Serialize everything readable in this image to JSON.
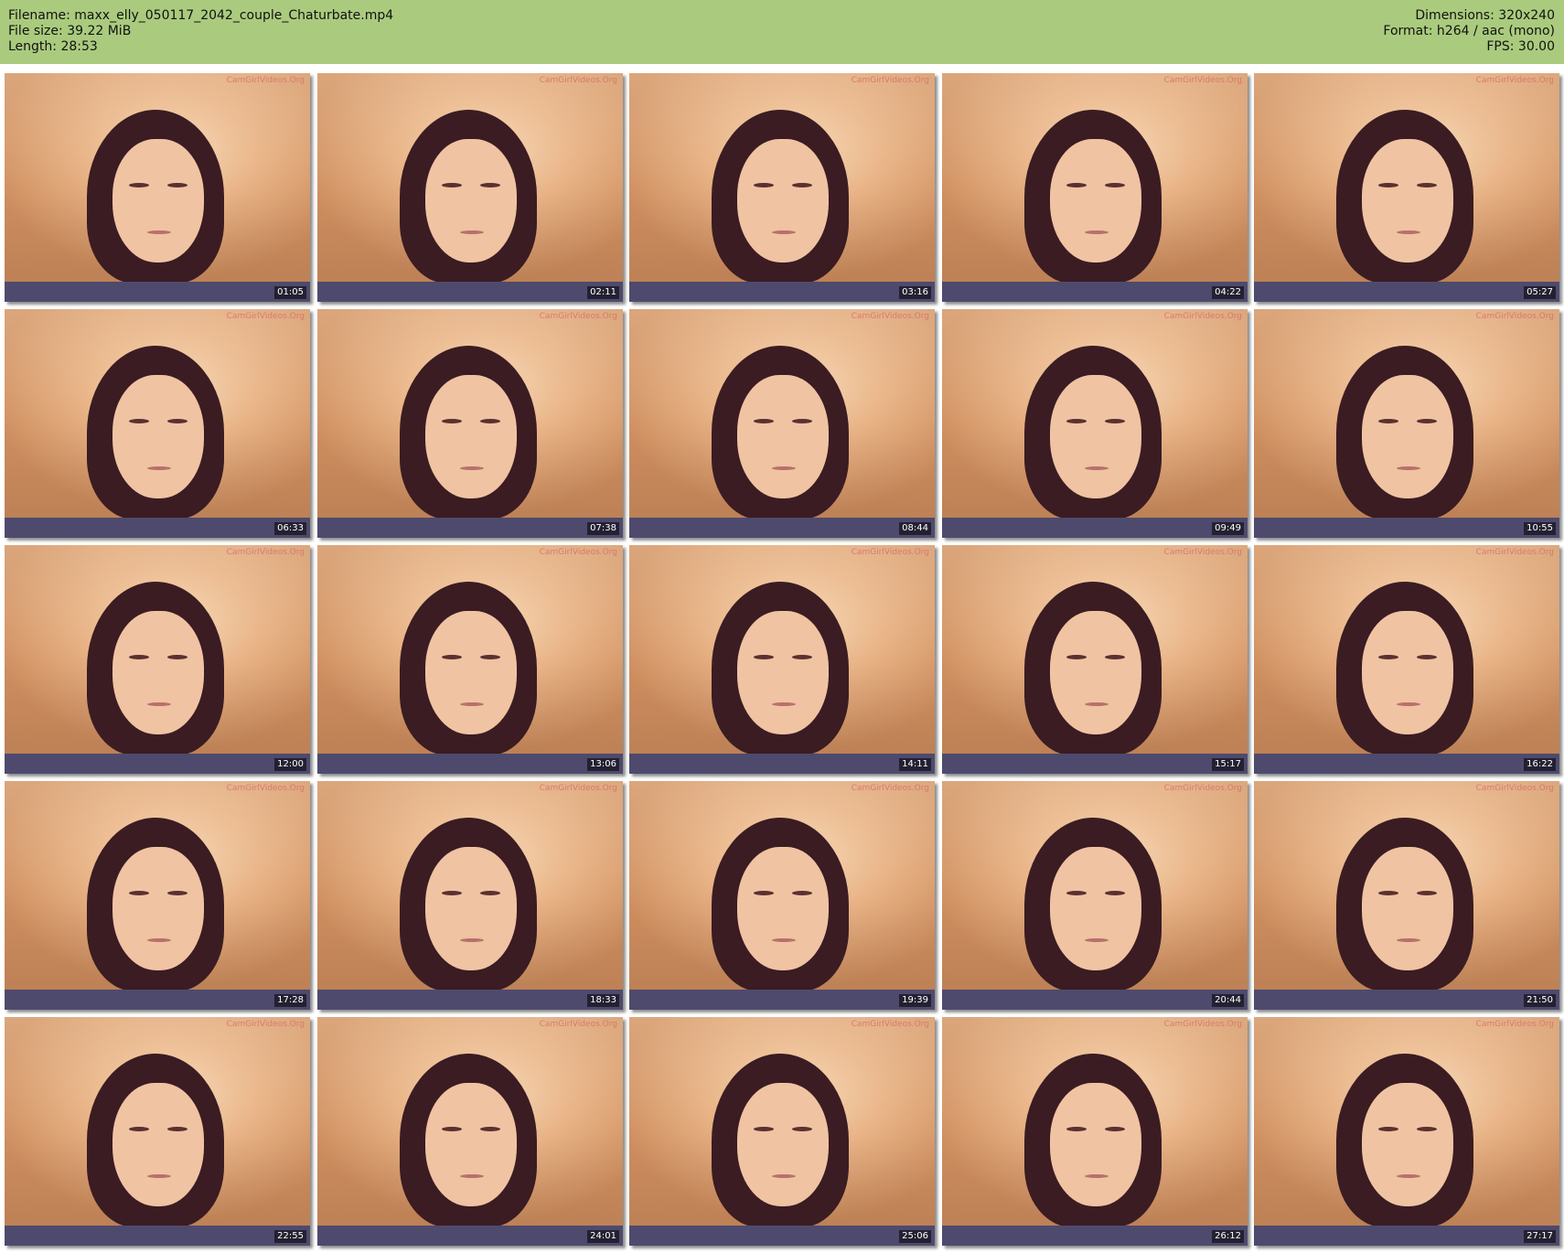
{
  "header": {
    "filename": "Filename: maxx_elly_050117_2042_couple_Chaturbate.mp4",
    "filesize": "File size: 39.22 MiB",
    "length": "Length: 28:53",
    "dimensions": "Dimensions: 320x240",
    "format": "Format: h264 / aac (mono)",
    "fps": "FPS: 30.00"
  },
  "watermark": "CamGirlVideos.Org",
  "thumbnails": [
    "01:05",
    "02:11",
    "03:16",
    "04:22",
    "05:27",
    "06:33",
    "07:38",
    "08:44",
    "09:49",
    "10:55",
    "12:00",
    "13:06",
    "14:11",
    "15:17",
    "16:22",
    "17:28",
    "18:33",
    "19:39",
    "20:44",
    "21:50",
    "22:55",
    "24:01",
    "25:06",
    "26:12",
    "27:17"
  ]
}
